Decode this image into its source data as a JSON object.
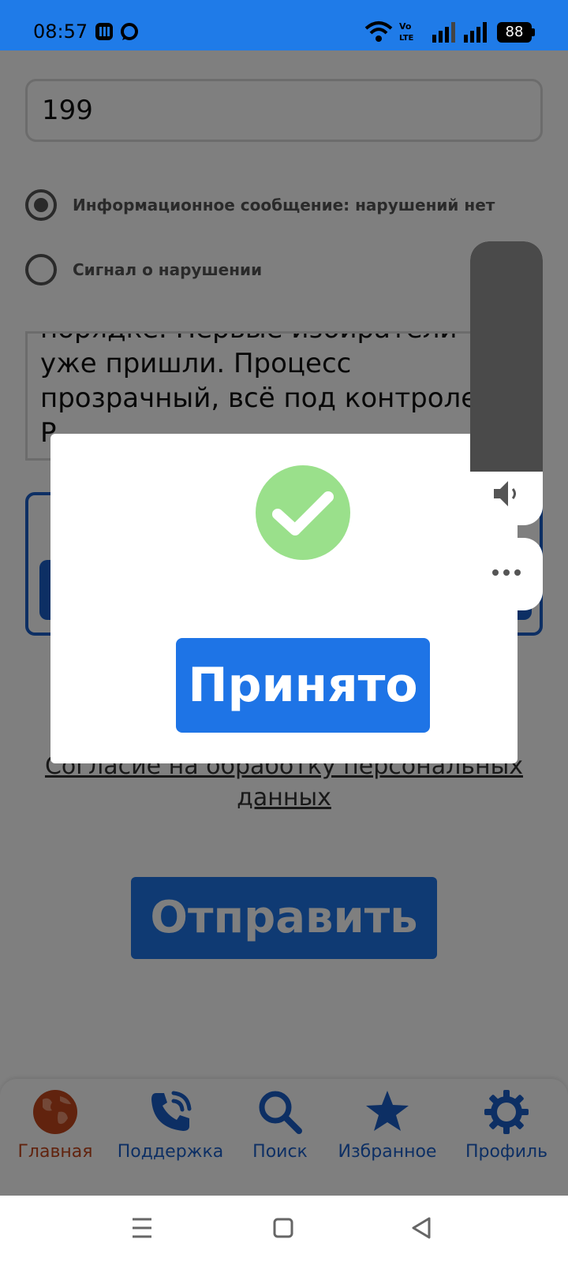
{
  "status_bar": {
    "time": "08:57",
    "battery": "88",
    "icons": [
      "app-icon",
      "chat-icon",
      "wifi-icon",
      "volte-icon",
      "signal-icon",
      "signal-icon",
      "battery-icon"
    ],
    "color": "#1f7be8"
  },
  "form": {
    "number_value": "199",
    "radio_options": [
      {
        "label": "Информационное сообщение: нарушений нет",
        "selected": true
      },
      {
        "label": "Сигнал о нарушении",
        "selected": false
      }
    ],
    "message_lines": [
      "порядке. Первые избиратели",
      "уже пришли. Процесс",
      "прозрачный, всё под контролем.",
      "Р"
    ],
    "consent_link": "Согласие на обработку персональных данных",
    "submit_label": "Отправить"
  },
  "modal": {
    "icon": "check-icon",
    "accept_label": "Принято"
  },
  "volume": {
    "level": 0.81,
    "icon": "speaker-icon",
    "more_icon": "more-dots-icon"
  },
  "bottom_nav": {
    "items": [
      {
        "label": "Главная",
        "icon": "globe-icon",
        "active": true
      },
      {
        "label": "Поддержка",
        "icon": "phone-icon",
        "active": false
      },
      {
        "label": "Поиск",
        "icon": "search-icon",
        "active": false
      },
      {
        "label": "Избранное",
        "icon": "star-icon",
        "active": false
      },
      {
        "label": "Профиль",
        "icon": "gear-icon",
        "active": false
      }
    ]
  },
  "colors": {
    "accent": "#1e74e6",
    "nav_active": "#c3471c",
    "nav_inactive": "#1a5fc9",
    "success": "#9ae08b"
  }
}
